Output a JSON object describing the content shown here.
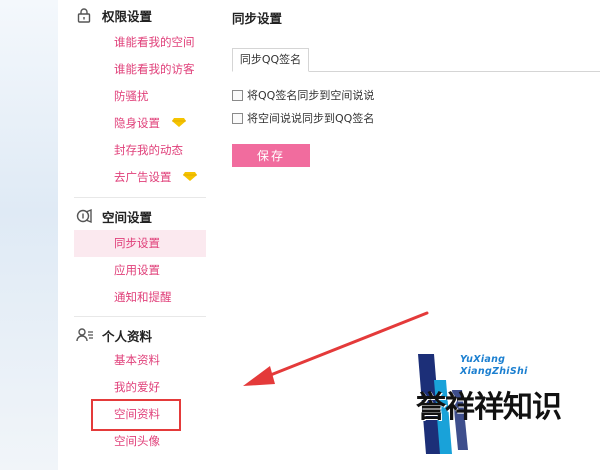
{
  "sidebar": {
    "sections": [
      {
        "title": "权限设置",
        "icon": "lock-icon",
        "items": [
          {
            "label": "谁能看我的空间",
            "gem": false
          },
          {
            "label": "谁能看我的访客",
            "gem": false
          },
          {
            "label": "防骚扰",
            "gem": false
          },
          {
            "label": "隐身设置",
            "gem": true
          },
          {
            "label": "封存我的动态",
            "gem": false
          },
          {
            "label": "去广告设置",
            "gem": true
          }
        ]
      },
      {
        "title": "空间设置",
        "icon": "space-settings-icon",
        "items": [
          {
            "label": "同步设置",
            "active": true
          },
          {
            "label": "应用设置"
          },
          {
            "label": "通知和提醒"
          }
        ]
      },
      {
        "title": "个人资料",
        "icon": "person-icon",
        "items": [
          {
            "label": "基本资料"
          },
          {
            "label": "我的爱好"
          },
          {
            "label": "空间资料",
            "highlighted": true
          },
          {
            "label": "空间头像"
          }
        ]
      }
    ]
  },
  "main": {
    "title": "同步设置",
    "tabs": [
      {
        "label": "同步QQ签名",
        "active": true
      }
    ],
    "options": [
      {
        "label": "将QQ签名同步到空间说说",
        "checked": false
      },
      {
        "label": "将空间说说同步到QQ签名",
        "checked": false
      }
    ],
    "save_label": "保存"
  },
  "watermark": {
    "line1": "YuXiang",
    "line2": "XiangZhiShi",
    "text": "誉祥祥知识"
  },
  "colors": {
    "accent": "#e0407a",
    "button": "#f16c9e",
    "active_bg": "#fbe9ef",
    "annotation": "#e43a3a",
    "gem": "#f5c400",
    "watermark_blue": "#1b7fd0"
  }
}
